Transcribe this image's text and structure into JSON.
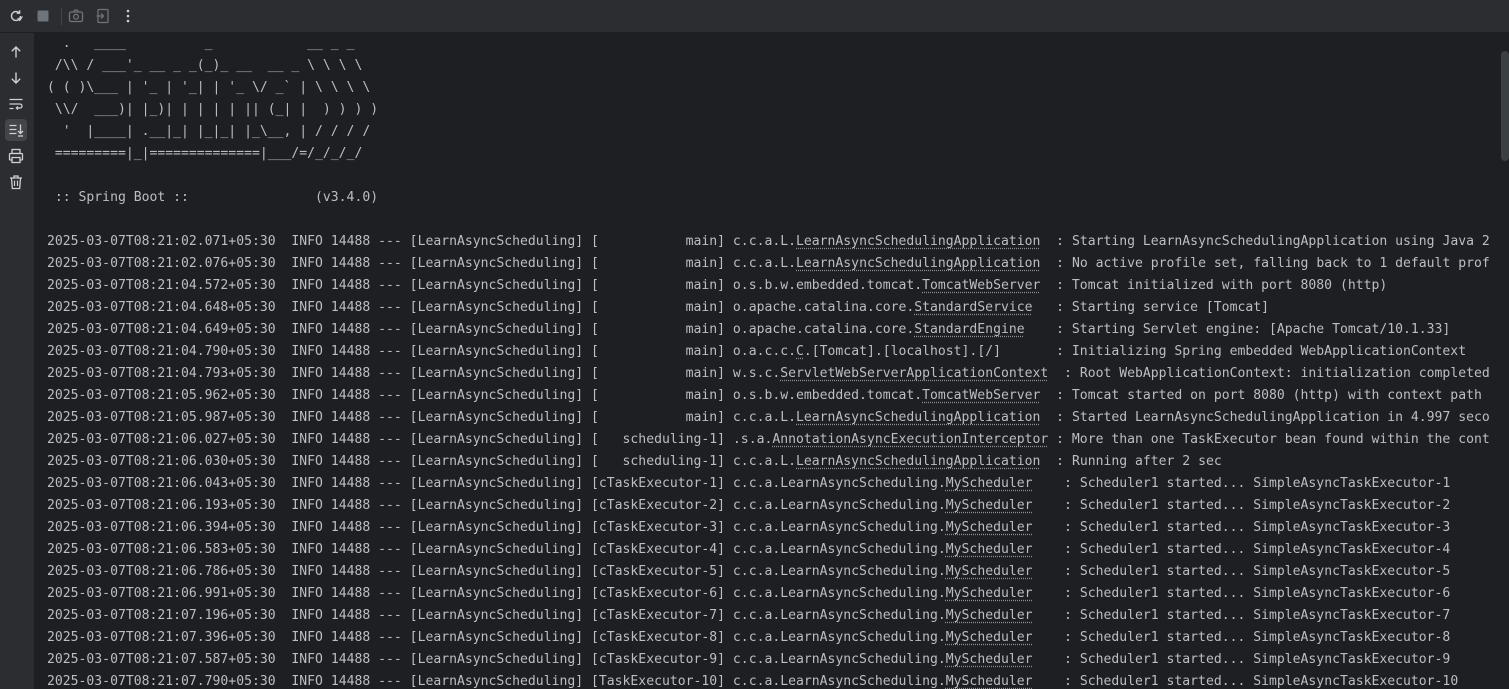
{
  "toolbar": {
    "icons": [
      "rerun-icon",
      "stop-icon",
      "screenshot-icon",
      "exit-icon",
      "more-icon"
    ]
  },
  "sidebar": {
    "icons": [
      "up-arrow-icon",
      "down-arrow-icon",
      "soft-wrap-icon",
      "scroll-to-end-icon",
      "print-icon",
      "trash-icon"
    ]
  },
  "banner": [
    "  .   ____          _            __ _ _",
    " /\\\\ / ___'_ __ _ _(_)_ __  __ _ \\ \\ \\ \\",
    "( ( )\\___ | '_ | '_| | '_ \\/ _` | \\ \\ \\ \\",
    " \\\\/  ___)| |_)| | | | | || (_| |  ) ) ) )",
    "  '  |____| .__|_| |_|_| |_\\__, | / / / /",
    " =========|_|==============|___/=/_/_/_/",
    "",
    " :: Spring Boot ::                (v3.4.0)"
  ],
  "log_lines": [
    {
      "ts": "2025-03-07T08:21:02.071+05:30",
      "level": " INFO",
      "pid": "14488",
      "app": "LearnAsyncScheduling",
      "thread": "           main",
      "logger_prefix": "c.c.a.L.",
      "logger_class": "LearnAsyncSchedulingApplication",
      "logger_pad": " ",
      "message": "Starting LearnAsyncSchedulingApplication using Java 2"
    },
    {
      "ts": "2025-03-07T08:21:02.076+05:30",
      "level": " INFO",
      "pid": "14488",
      "app": "LearnAsyncScheduling",
      "thread": "           main",
      "logger_prefix": "c.c.a.L.",
      "logger_class": "LearnAsyncSchedulingApplication",
      "logger_pad": " ",
      "message": "No active profile set, falling back to 1 default prof"
    },
    {
      "ts": "2025-03-07T08:21:04.572+05:30",
      "level": " INFO",
      "pid": "14488",
      "app": "LearnAsyncScheduling",
      "thread": "           main",
      "logger_prefix": "o.s.b.w.embedded.tomcat.",
      "logger_class": "TomcatWebServer",
      "logger_pad": " ",
      "message": "Tomcat initialized with port 8080 (http)"
    },
    {
      "ts": "2025-03-07T08:21:04.648+05:30",
      "level": " INFO",
      "pid": "14488",
      "app": "LearnAsyncScheduling",
      "thread": "           main",
      "logger_prefix": "o.apache.catalina.core.",
      "logger_class": "StandardService",
      "logger_pad": "  ",
      "message": "Starting service [Tomcat]"
    },
    {
      "ts": "2025-03-07T08:21:04.649+05:30",
      "level": " INFO",
      "pid": "14488",
      "app": "LearnAsyncScheduling",
      "thread": "           main",
      "logger_prefix": "o.apache.catalina.core.",
      "logger_class": "StandardEngine",
      "logger_pad": "   ",
      "message": "Starting Servlet engine: [Apache Tomcat/10.1.33]"
    },
    {
      "ts": "2025-03-07T08:21:04.790+05:30",
      "level": " INFO",
      "pid": "14488",
      "app": "LearnAsyncScheduling",
      "thread": "           main",
      "logger_prefix": "o.a.c.c.",
      "logger_class": "C",
      "logger_suffix": ".[Tomcat].[localhost].[/]",
      "logger_pad": "      ",
      "message": "Initializing Spring embedded WebApplicationContext"
    },
    {
      "ts": "2025-03-07T08:21:04.793+05:30",
      "level": " INFO",
      "pid": "14488",
      "app": "LearnAsyncScheduling",
      "thread": "           main",
      "logger_prefix": "w.s.c.",
      "logger_class": "ServletWebServerApplicationContext",
      "logger_pad": " ",
      "message": "Root WebApplicationContext: initialization completed"
    },
    {
      "ts": "2025-03-07T08:21:05.962+05:30",
      "level": " INFO",
      "pid": "14488",
      "app": "LearnAsyncScheduling",
      "thread": "           main",
      "logger_prefix": "o.s.b.w.embedded.tomcat.",
      "logger_class": "TomcatWebServer",
      "logger_pad": " ",
      "message": "Tomcat started on port 8080 (http) with context path"
    },
    {
      "ts": "2025-03-07T08:21:05.987+05:30",
      "level": " INFO",
      "pid": "14488",
      "app": "LearnAsyncScheduling",
      "thread": "           main",
      "logger_prefix": "c.c.a.L.",
      "logger_class": "LearnAsyncSchedulingApplication",
      "logger_pad": " ",
      "message": "Started LearnAsyncSchedulingApplication in 4.997 seco"
    },
    {
      "ts": "2025-03-07T08:21:06.027+05:30",
      "level": " INFO",
      "pid": "14488",
      "app": "LearnAsyncScheduling",
      "thread": "   scheduling-1",
      "logger_prefix": ".s.a.",
      "logger_class": "AnnotationAsyncExecutionInterceptor",
      "logger_pad": "",
      "message": "More than one TaskExecutor bean found within the cont"
    },
    {
      "ts": "2025-03-07T08:21:06.030+05:30",
      "level": " INFO",
      "pid": "14488",
      "app": "LearnAsyncScheduling",
      "thread": "   scheduling-1",
      "logger_prefix": "c.c.a.L.",
      "logger_class": "LearnAsyncSchedulingApplication",
      "logger_pad": " ",
      "message": "Running after 2 sec"
    },
    {
      "ts": "2025-03-07T08:21:06.043+05:30",
      "level": " INFO",
      "pid": "14488",
      "app": "LearnAsyncScheduling",
      "thread": "cTaskExecutor-1",
      "logger_prefix": "c.c.a.LearnAsyncScheduling.",
      "logger_class": "MyScheduler",
      "logger_pad": "   ",
      "message": "Scheduler1 started... SimpleAsyncTaskExecutor-1"
    },
    {
      "ts": "2025-03-07T08:21:06.193+05:30",
      "level": " INFO",
      "pid": "14488",
      "app": "LearnAsyncScheduling",
      "thread": "cTaskExecutor-2",
      "logger_prefix": "c.c.a.LearnAsyncScheduling.",
      "logger_class": "MyScheduler",
      "logger_pad": "   ",
      "message": "Scheduler1 started... SimpleAsyncTaskExecutor-2"
    },
    {
      "ts": "2025-03-07T08:21:06.394+05:30",
      "level": " INFO",
      "pid": "14488",
      "app": "LearnAsyncScheduling",
      "thread": "cTaskExecutor-3",
      "logger_prefix": "c.c.a.LearnAsyncScheduling.",
      "logger_class": "MyScheduler",
      "logger_pad": "   ",
      "message": "Scheduler1 started... SimpleAsyncTaskExecutor-3"
    },
    {
      "ts": "2025-03-07T08:21:06.583+05:30",
      "level": " INFO",
      "pid": "14488",
      "app": "LearnAsyncScheduling",
      "thread": "cTaskExecutor-4",
      "logger_prefix": "c.c.a.LearnAsyncScheduling.",
      "logger_class": "MyScheduler",
      "logger_pad": "   ",
      "message": "Scheduler1 started... SimpleAsyncTaskExecutor-4"
    },
    {
      "ts": "2025-03-07T08:21:06.786+05:30",
      "level": " INFO",
      "pid": "14488",
      "app": "LearnAsyncScheduling",
      "thread": "cTaskExecutor-5",
      "logger_prefix": "c.c.a.LearnAsyncScheduling.",
      "logger_class": "MyScheduler",
      "logger_pad": "   ",
      "message": "Scheduler1 started... SimpleAsyncTaskExecutor-5"
    },
    {
      "ts": "2025-03-07T08:21:06.991+05:30",
      "level": " INFO",
      "pid": "14488",
      "app": "LearnAsyncScheduling",
      "thread": "cTaskExecutor-6",
      "logger_prefix": "c.c.a.LearnAsyncScheduling.",
      "logger_class": "MyScheduler",
      "logger_pad": "   ",
      "message": "Scheduler1 started... SimpleAsyncTaskExecutor-6"
    },
    {
      "ts": "2025-03-07T08:21:07.196+05:30",
      "level": " INFO",
      "pid": "14488",
      "app": "LearnAsyncScheduling",
      "thread": "cTaskExecutor-7",
      "logger_prefix": "c.c.a.LearnAsyncScheduling.",
      "logger_class": "MyScheduler",
      "logger_pad": "   ",
      "message": "Scheduler1 started... SimpleAsyncTaskExecutor-7"
    },
    {
      "ts": "2025-03-07T08:21:07.396+05:30",
      "level": " INFO",
      "pid": "14488",
      "app": "LearnAsyncScheduling",
      "thread": "cTaskExecutor-8",
      "logger_prefix": "c.c.a.LearnAsyncScheduling.",
      "logger_class": "MyScheduler",
      "logger_pad": "   ",
      "message": "Scheduler1 started... SimpleAsyncTaskExecutor-8"
    },
    {
      "ts": "2025-03-07T08:21:07.587+05:30",
      "level": " INFO",
      "pid": "14488",
      "app": "LearnAsyncScheduling",
      "thread": "cTaskExecutor-9",
      "logger_prefix": "c.c.a.LearnAsyncScheduling.",
      "logger_class": "MyScheduler",
      "logger_pad": "   ",
      "message": "Scheduler1 started... SimpleAsyncTaskExecutor-9"
    },
    {
      "ts": "2025-03-07T08:21:07.790+05:30",
      "level": " INFO",
      "pid": "14488",
      "app": "LearnAsyncScheduling",
      "thread": "TaskExecutor-10",
      "logger_prefix": "c.c.a.LearnAsyncScheduling.",
      "logger_class": "MyScheduler",
      "logger_pad": "   ",
      "message": "Scheduler1 started... SimpleAsyncTaskExecutor-10"
    }
  ],
  "colors": {
    "background": "#1e1f22",
    "toolbar": "#2b2d30",
    "text": "#bcbec4",
    "icon": "#ced0d6",
    "icon_disabled": "#6f737a"
  }
}
